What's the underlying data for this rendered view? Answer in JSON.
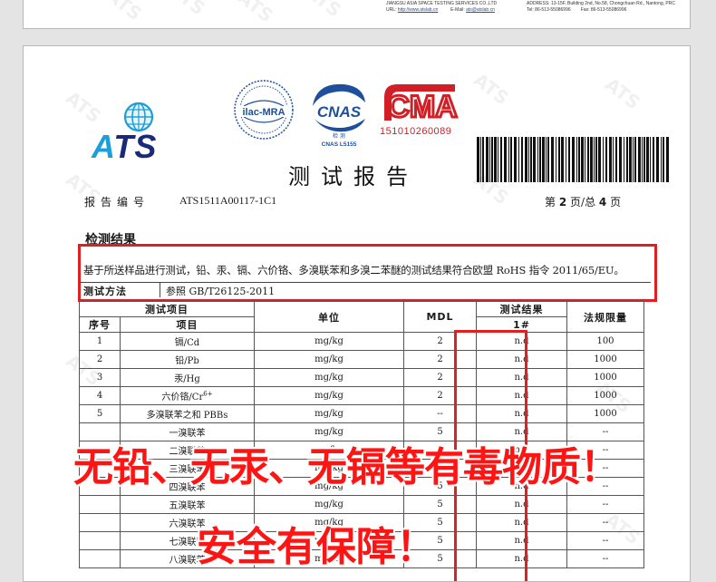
{
  "prev_page": {
    "lab_name": "JIANGSU ASIA SPACE TESTING SERVICES CO.,LTD",
    "url_label": "URL:",
    "url": "http://www.atslab.cn",
    "email_label": "E-Mail:",
    "email": "ats@atslab.cn",
    "address_label": "ADDRESS:",
    "address": "13-15F, Building 2nd, No.58, Chongchuan Rd., Nantong, PRC",
    "tel_label": "Tel:",
    "tel": "86-513-55086996",
    "fax_label": "Fax:",
    "fax": "86-513-55086996"
  },
  "header": {
    "ats_logo_text": "ATS",
    "ilac_text": "ilac-MRA",
    "cnas_text": "CNAS",
    "cnas_sub": "检 测",
    "cnas_code": "CNAS L5155",
    "cma_text": "CMA",
    "cma_number": "151010260089",
    "report_title": "测试报告",
    "report_no_label": "报告编号",
    "report_no": "ATS1511A00117-1C1",
    "page_prefix": "第",
    "page_current": "2",
    "page_mid": "页/总",
    "page_total": "4",
    "page_suffix": "页"
  },
  "section": {
    "title": "检测结果",
    "summary": "基于所送样品进行测试，铅、汞、镉、六价铬、多溴联苯和多溴二苯醚的测试结果符合欧盟 RoHS 指令 2011/65/EU。",
    "method_label": "测试方法",
    "method_value": "参照 GB/T26125-2011"
  },
  "table": {
    "col_test_items": "测试项目",
    "col_no": "序号",
    "col_item": "项目",
    "col_unit": "单位",
    "col_mdl": "MDL",
    "col_result": "测试结果",
    "col_sample": "1#",
    "col_limit": "法规限量",
    "rows": [
      {
        "no": "1",
        "item": "镉/Cd",
        "unit": "mg/kg",
        "mdl": "2",
        "result": "n.d",
        "limit": "100"
      },
      {
        "no": "2",
        "item": "铅/Pb",
        "unit": "mg/kg",
        "mdl": "2",
        "result": "n.d",
        "limit": "1000"
      },
      {
        "no": "3",
        "item": "汞/Hg",
        "unit": "mg/kg",
        "mdl": "2",
        "result": "n.d",
        "limit": "1000"
      },
      {
        "no": "4",
        "item": "六价铬/Cr",
        "item_sup": "6+",
        "unit": "mg/kg",
        "mdl": "2",
        "result": "n.d",
        "limit": "1000"
      },
      {
        "no": "5",
        "item": "多溴联苯之和 PBBs",
        "unit": "mg/kg",
        "mdl": "--",
        "result": "n.d",
        "limit": "1000"
      },
      {
        "no": "",
        "item": "一溴联苯",
        "unit": "mg/kg",
        "mdl": "5",
        "result": "n.d",
        "limit": "--"
      },
      {
        "no": "",
        "item": "二溴联苯",
        "unit": "mg/kg",
        "mdl": "5",
        "result": "n.d",
        "limit": "--"
      },
      {
        "no": "",
        "item": "三溴联苯",
        "unit": "mg/kg",
        "mdl": "5",
        "result": "n.d",
        "limit": "--"
      },
      {
        "no": "",
        "item": "四溴联苯",
        "unit": "mg/kg",
        "mdl": "5",
        "result": "n.d",
        "limit": "--"
      },
      {
        "no": "",
        "item": "五溴联苯",
        "unit": "mg/kg",
        "mdl": "5",
        "result": "n.d",
        "limit": "--"
      },
      {
        "no": "",
        "item": "六溴联苯",
        "unit": "mg/kg",
        "mdl": "5",
        "result": "n.d",
        "limit": "--"
      },
      {
        "no": "",
        "item": "七溴联苯",
        "unit": "mg/kg",
        "mdl": "5",
        "result": "n.d",
        "limit": "--"
      },
      {
        "no": "",
        "item": "八溴联苯",
        "unit": "mg/kg",
        "mdl": "5",
        "result": "n.d",
        "limit": "--"
      }
    ]
  },
  "promo": {
    "line1": "无铅、无汞、无镉等有毒物质！",
    "line2": "安全有保障！"
  },
  "watermark_text": "ATS",
  "colors": {
    "red": "#e02020",
    "promo_red": "#ff1414",
    "ats_navy": "#1a2a7a",
    "ats_blue": "#1a9fd8",
    "cnas_blue": "#1d4f9c",
    "cma_red": "#d21f26"
  }
}
